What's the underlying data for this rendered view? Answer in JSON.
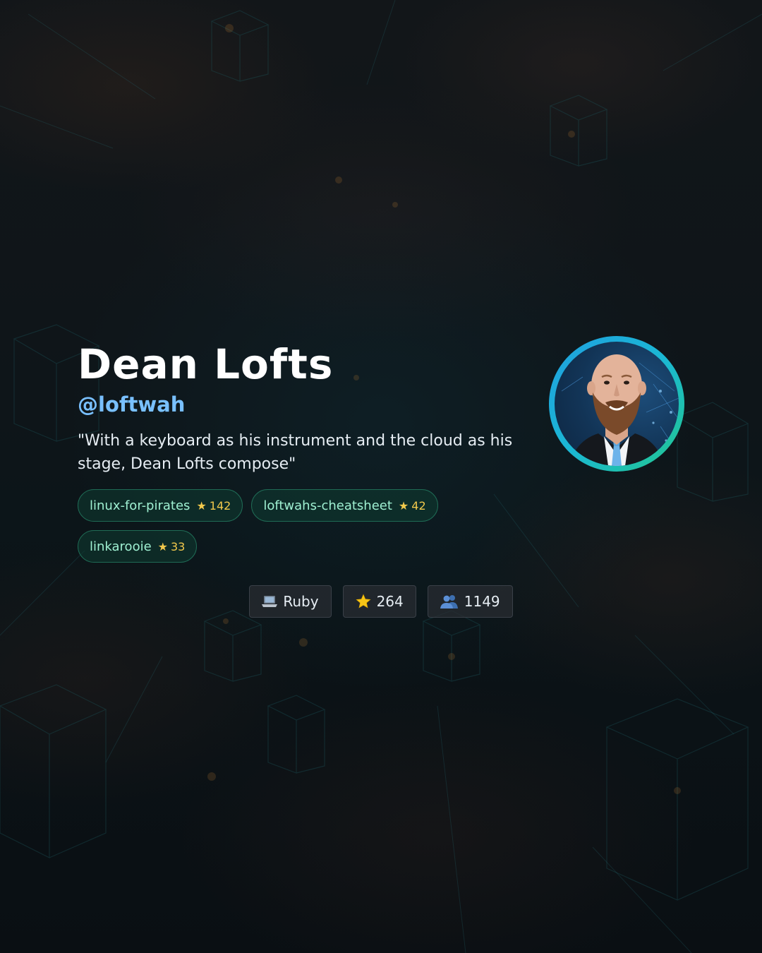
{
  "profile": {
    "name": "Dean Lofts",
    "handle": "@loftwah",
    "tagline": "\"With a keyboard as his instrument and the cloud as his stage, Dean Lofts compose\""
  },
  "repos": [
    {
      "name": "linux-for-pirates",
      "stars": "142"
    },
    {
      "name": "loftwahs-cheatsheet",
      "stars": "42"
    },
    {
      "name": "linkarooie",
      "stars": "33"
    }
  ],
  "stats": {
    "language": {
      "icon": "laptop-icon",
      "value": "Ruby"
    },
    "stars": {
      "icon": "star-icon",
      "value": "264"
    },
    "followers": {
      "icon": "people-icon",
      "value": "1149"
    }
  },
  "colors": {
    "name": "#ffffff",
    "handle": "#79c0ff",
    "repo_text": "#9ff0d2",
    "repo_border": "#1f6b55",
    "star": "#f2c94c",
    "avatar_ring_start": "#1f9fe0",
    "avatar_ring_end": "#22c78d"
  }
}
